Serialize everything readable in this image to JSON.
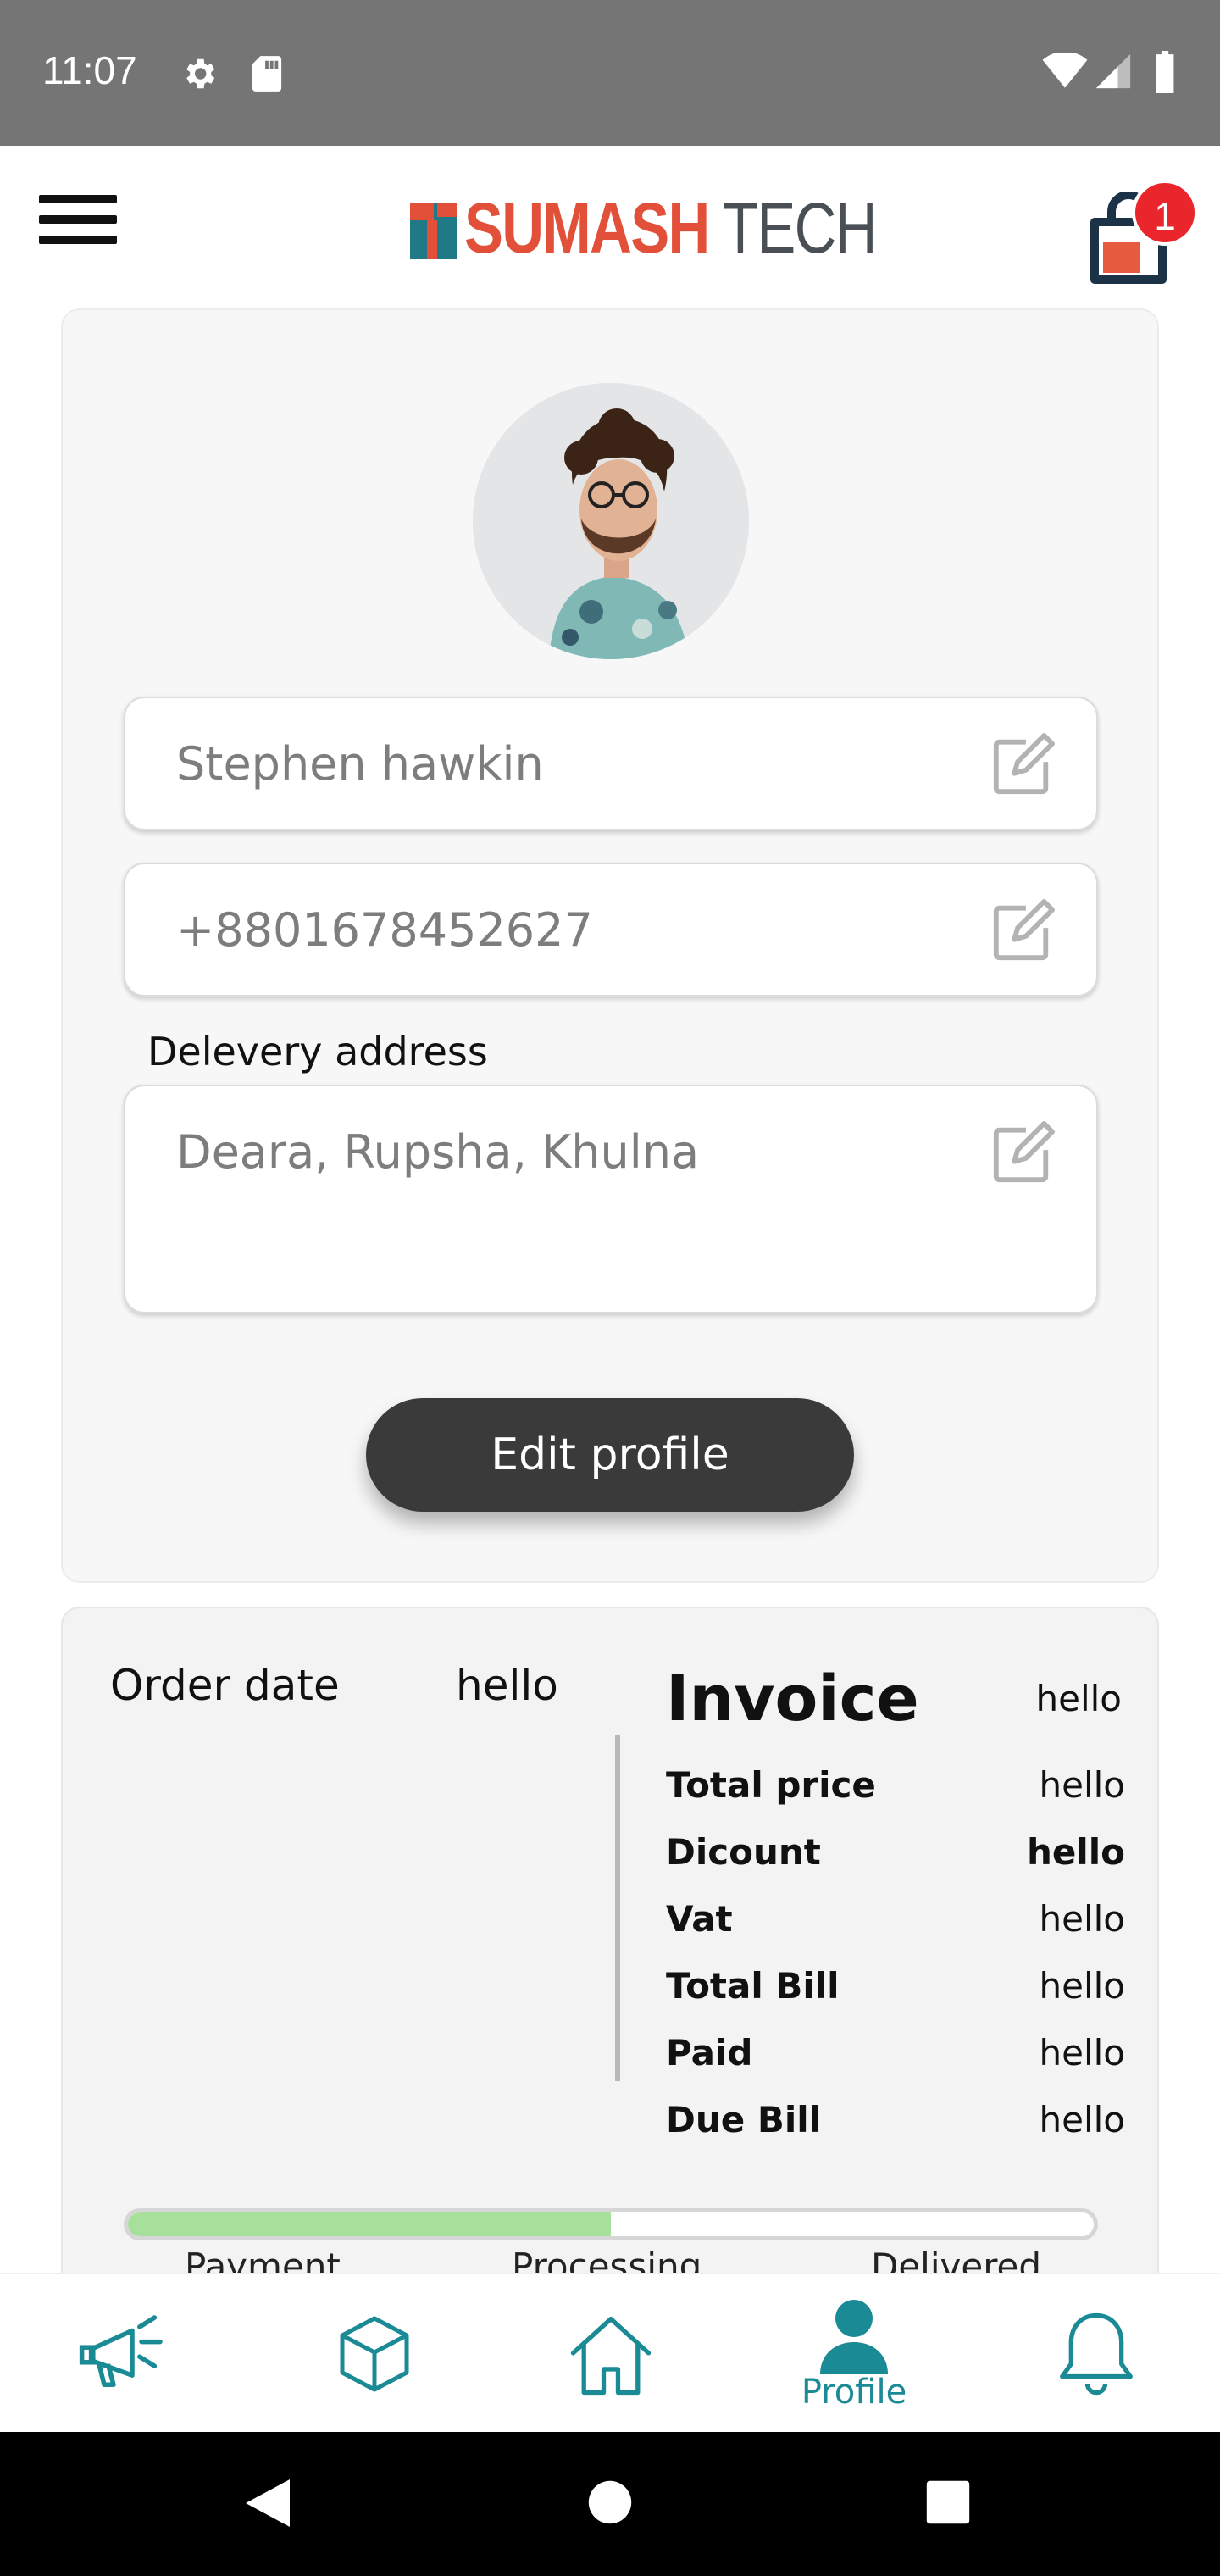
{
  "status_bar": {
    "time": "11:07",
    "icons": [
      "gear-icon",
      "sd-card-icon",
      "wifi-icon",
      "signal-icon",
      "battery-icon"
    ]
  },
  "app_bar": {
    "brand_primary": "SUMASH",
    "brand_secondary": "TECH",
    "cart_count": "1",
    "colors": {
      "brand_red": "#e2503a",
      "brand_teal": "#1f7a86",
      "badge": "#e8262b"
    }
  },
  "profile": {
    "name": "Stephen hawkin",
    "phone": "+8801678452627",
    "address_label": "Delevery address",
    "address": "Deara, Rupsha, Khulna",
    "edit_button": "Edit profile"
  },
  "order": {
    "date_label": "Order date",
    "date_value": "hello",
    "invoice_title": "Invoice",
    "invoice_title_value": "hello",
    "rows": [
      {
        "label": "Total price",
        "value": "hello"
      },
      {
        "label": "Dicount",
        "value": "hello"
      },
      {
        "label": "Vat",
        "value": "hello"
      },
      {
        "label": "Total Bill",
        "value": "hello"
      },
      {
        "label": "Paid",
        "value": "hello"
      },
      {
        "label": "Due Bill",
        "value": "hello"
      }
    ],
    "progress": {
      "fraction": 0.5,
      "steps": [
        "Payment",
        "Processing",
        "Delivered"
      ]
    }
  },
  "bottom_nav": {
    "items": [
      {
        "icon": "megaphone-icon",
        "label": ""
      },
      {
        "icon": "box-icon",
        "label": ""
      },
      {
        "icon": "home-icon",
        "label": ""
      },
      {
        "icon": "profile-icon",
        "label": "Profile"
      },
      {
        "icon": "bell-icon",
        "label": ""
      }
    ],
    "active": "Profile",
    "accent": "#1a8a95"
  }
}
